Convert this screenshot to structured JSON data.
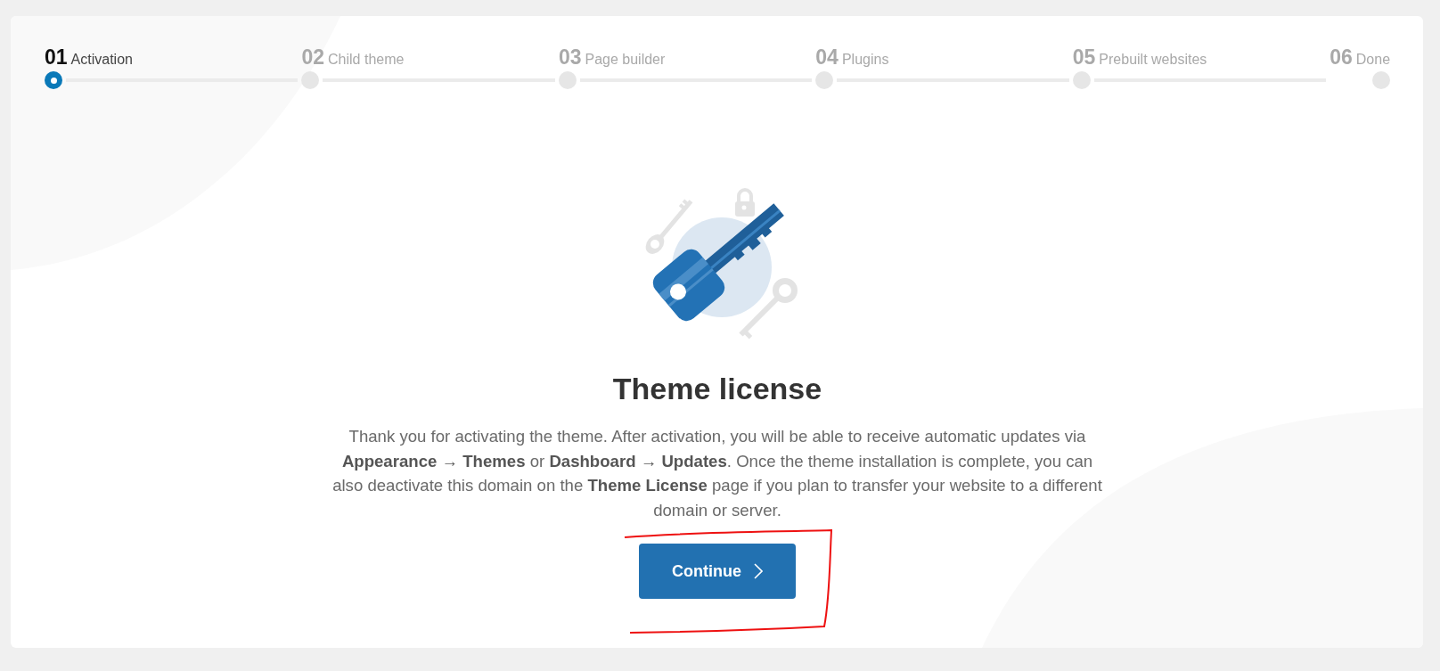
{
  "steps": [
    {
      "number": "01",
      "label": "Activation",
      "selected": true
    },
    {
      "number": "02",
      "label": "Child theme",
      "selected": false
    },
    {
      "number": "03",
      "label": "Page builder",
      "selected": false
    },
    {
      "number": "04",
      "label": "Plugins",
      "selected": false
    },
    {
      "number": "05",
      "label": "Prebuilt websites",
      "selected": false
    },
    {
      "number": "06",
      "label": "Done",
      "selected": false
    }
  ],
  "title": "Theme license",
  "description": "Thank you for activating the theme. After activation, you will be able to receive automatic updates via **Appearance → Themes** or **Dashboard → Updates**. Once the theme installation is complete, you can also deactivate this domain on the **Theme License** page if you plan to transfer your website to a different domain or server.",
  "button": {
    "label": "Continue"
  }
}
